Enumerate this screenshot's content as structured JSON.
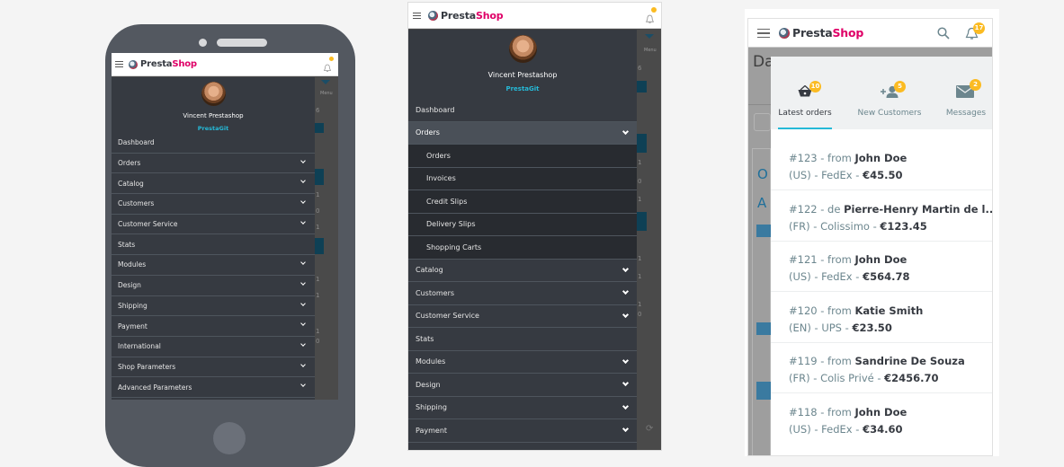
{
  "brand": {
    "part1": "Presta",
    "part2": "Shop"
  },
  "profile": {
    "name": "Vincent Prestashop",
    "shop": "PrestaGit"
  },
  "phone1": {
    "notification_count": "",
    "background_menu_label": "Menu",
    "background_numbers": [
      "6",
      "1",
      "0",
      "1",
      "1",
      "1",
      "1",
      "0"
    ],
    "menu": [
      {
        "label": "Dashboard",
        "expandable": false
      },
      {
        "label": "Orders",
        "expandable": true
      },
      {
        "label": "Catalog",
        "expandable": true
      },
      {
        "label": "Customers",
        "expandable": true
      },
      {
        "label": "Customer Service",
        "expandable": true
      },
      {
        "label": "Stats",
        "expandable": false
      },
      {
        "label": "Modules",
        "expandable": true
      },
      {
        "label": "Design",
        "expandable": true
      },
      {
        "label": "Shipping",
        "expandable": true
      },
      {
        "label": "Payment",
        "expandable": true
      },
      {
        "label": "International",
        "expandable": true
      },
      {
        "label": "Shop Parameters",
        "expandable": true
      },
      {
        "label": "Advanced Parameters",
        "expandable": true
      }
    ]
  },
  "phone2": {
    "background_menu_label": "Menu",
    "background_numbers": [
      "6",
      "1",
      "0",
      "1",
      "1",
      "1",
      "1",
      "0"
    ],
    "menu": [
      {
        "label": "Dashboard",
        "expandable": false
      },
      {
        "label": "Orders",
        "expandable": true,
        "active": true,
        "children": [
          "Orders",
          "Invoices",
          "Credit Slips",
          "Delivery Slips",
          "Shopping Carts"
        ]
      },
      {
        "label": "Catalog",
        "expandable": true
      },
      {
        "label": "Customers",
        "expandable": true
      },
      {
        "label": "Customer Service",
        "expandable": true
      },
      {
        "label": "Stats",
        "expandable": false
      },
      {
        "label": "Modules",
        "expandable": true
      },
      {
        "label": "Design",
        "expandable": true
      },
      {
        "label": "Shipping",
        "expandable": true
      },
      {
        "label": "Payment",
        "expandable": true
      }
    ]
  },
  "phone3": {
    "bell_count": "17",
    "background_title": "Da",
    "tabs": [
      {
        "label": "Latest orders",
        "count": "10",
        "icon": "basket-icon",
        "active": true
      },
      {
        "label": "New Customers",
        "count": "5",
        "icon": "add-user-icon",
        "active": false
      },
      {
        "label": "Messages",
        "count": "2",
        "icon": "envelope-icon",
        "active": false
      }
    ],
    "orders": [
      {
        "id": "#123",
        "sep": " - from ",
        "customer": "John Doe",
        "country": "(US)",
        "carrier": "FedEx",
        "total": "€45.50"
      },
      {
        "id": "#122",
        "sep": " - de ",
        "customer": "Pierre-Henry Martin de l...",
        "country": "(FR)",
        "carrier": "Colissimo",
        "total": "€123.45"
      },
      {
        "id": "#121",
        "sep": " - from ",
        "customer": "John Doe",
        "country": "(US)",
        "carrier": "FedEx",
        "total": "€564.78"
      },
      {
        "id": "#120",
        "sep": " - from ",
        "customer": "Katie Smith",
        "country": "(EN)",
        "carrier": "UPS",
        "total": "€23.50"
      },
      {
        "id": "#119",
        "sep": " - from ",
        "customer": "Sandrine De Souza",
        "country": "(FR)",
        "carrier": "Colis Privé",
        "total": "€2456.70"
      },
      {
        "id": "#118",
        "sep": " - from ",
        "customer": "John Doe",
        "country": "(US)",
        "carrier": "FedEx",
        "total": "€34.60"
      }
    ]
  },
  "colors": {
    "accent": "#25b9d7",
    "brand_pink": "#df0067",
    "sidebar": "#363a41",
    "badge": "#fbbb22"
  }
}
